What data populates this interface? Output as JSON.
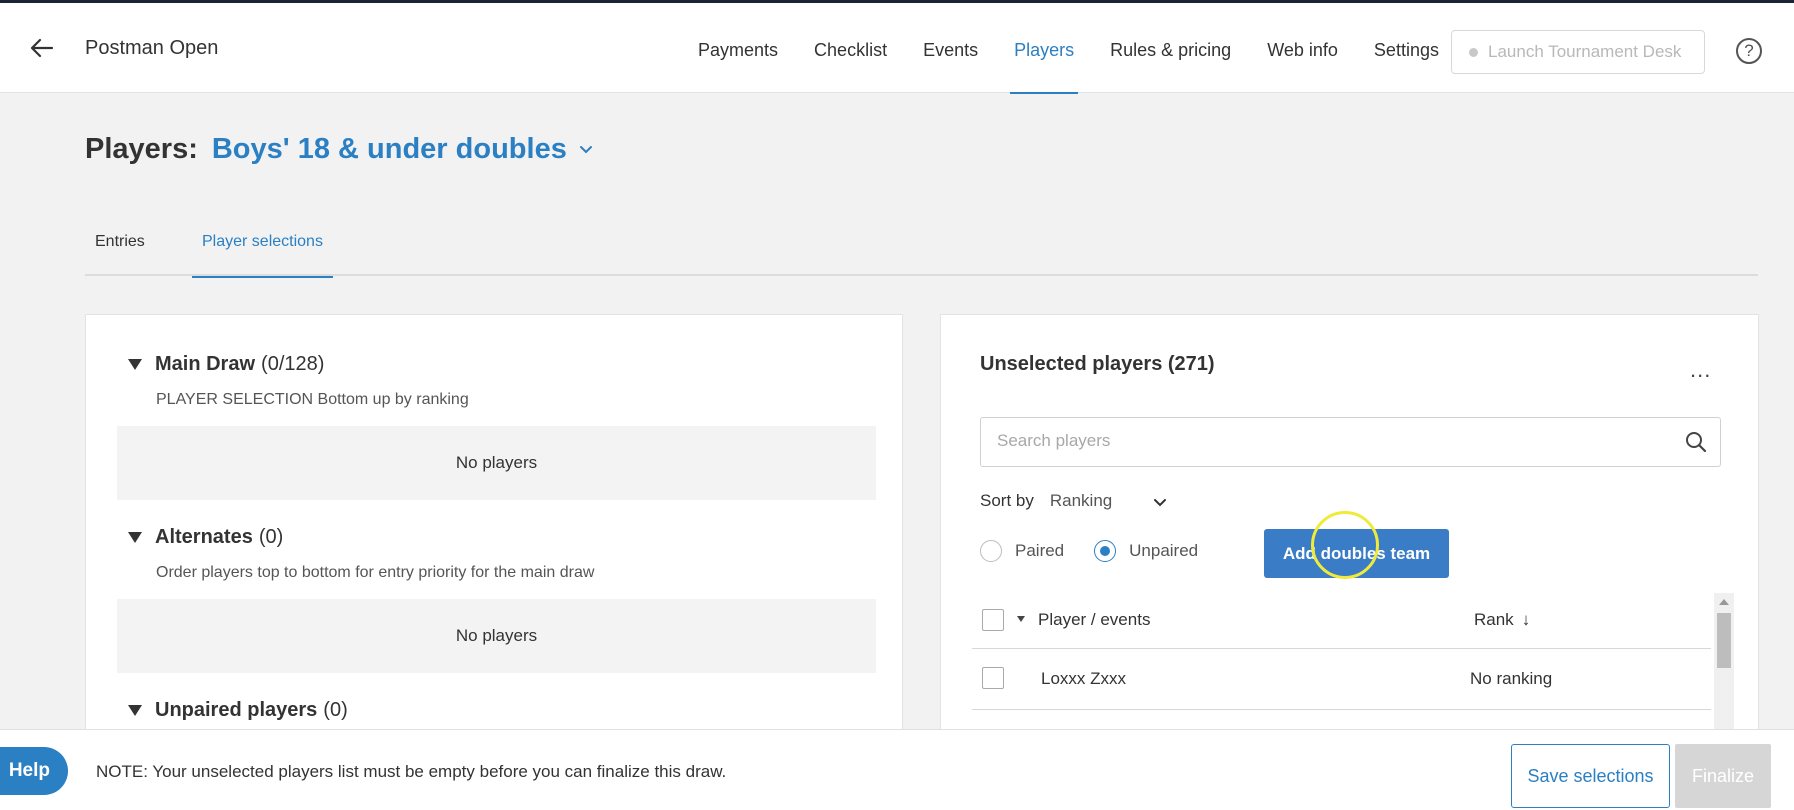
{
  "header": {
    "tournament_name": "Postman Open",
    "nav": [
      "Payments",
      "Checklist",
      "Events",
      "Players",
      "Rules & pricing",
      "Web info",
      "Settings"
    ],
    "active_nav": "Players",
    "launch_label": "Launch Tournament Desk",
    "help_glyph": "?"
  },
  "page": {
    "title_label": "Players:",
    "event_name": "Boys' 18 & under doubles",
    "tabs": [
      "Entries",
      "Player selections"
    ],
    "active_tab": "Player selections"
  },
  "left_panel": {
    "sections": [
      {
        "name": "Main Draw",
        "count": "(0/128)",
        "subtitle": "PLAYER SELECTION Bottom up by ranking",
        "empty_text": "No players"
      },
      {
        "name": "Alternates",
        "count": "(0)",
        "subtitle": "Order players top to bottom for entry priority for the main draw",
        "empty_text": "No players"
      },
      {
        "name": "Unpaired players",
        "count": "(0)"
      }
    ]
  },
  "right_panel": {
    "title": "Unselected players (271)",
    "more_glyph": "...",
    "search_placeholder": "Search players",
    "sort_label": "Sort by",
    "sort_value": "Ranking",
    "radio_paired": "Paired",
    "radio_unpaired": "Unpaired",
    "radio_selected": "Unpaired",
    "add_button": "Add doubles team",
    "columns": {
      "player": "Player / events",
      "rank": "Rank",
      "rank_arrow": "↓"
    },
    "rows": [
      {
        "player": "Loxxx Zxxx",
        "rank": "No ranking"
      }
    ]
  },
  "footer": {
    "help_label": "Help",
    "note": "NOTE: Your unselected players list must be empty before you can finalize this draw.",
    "save_label": "Save selections",
    "finalize_label": "Finalize"
  },
  "colors": {
    "accent": "#2b7fc3",
    "button": "#3a7cc5",
    "disabled": "#d6d6d6"
  }
}
